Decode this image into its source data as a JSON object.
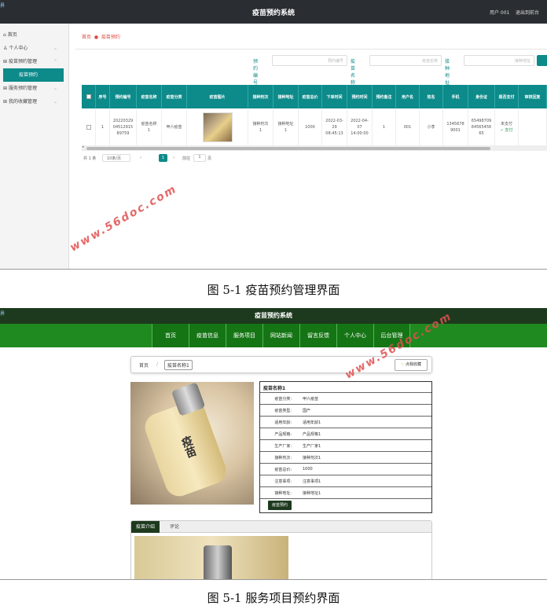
{
  "fig1": {
    "corner": "界",
    "system_title": "疫苗预约系统",
    "user_text": "用户 001",
    "logout": "退出到前台",
    "sidebar": [
      {
        "icon": "home-icon",
        "label": "首页"
      },
      {
        "icon": "user-icon",
        "label": "个人中心"
      },
      {
        "icon": "grid-icon",
        "label": "疫苗预约管理"
      },
      {
        "label": "疫苗预约"
      },
      {
        "icon": "grid-icon",
        "label": "服务预约管理"
      },
      {
        "icon": "grid-icon",
        "label": "我的收藏管理"
      }
    ],
    "breadcrumb": {
      "home": "首页",
      "current": "疫苗预约"
    },
    "search": [
      {
        "label": "预约编号",
        "placeholder": "预约编号"
      },
      {
        "label": "疫苗名称",
        "placeholder": "疫苗名称"
      },
      {
        "label": "接种地址",
        "placeholder": "接种地址"
      }
    ],
    "columns": [
      "",
      "序号",
      "预约编号",
      "疫苗名称",
      "疫苗分类",
      "疫苗图片",
      "接种剂次",
      "接种地址",
      "疫苗总价",
      "下单时间",
      "预约时间",
      "预约备注",
      "用户名",
      "姓名",
      "手机",
      "身份证",
      "是否支付",
      "审核回复"
    ],
    "row": {
      "index": "1",
      "order_no": "202203290451291589759",
      "name": "疫苗名称1",
      "category": "甲六疫苗",
      "dose": "接种剂次1",
      "address": "接种地址1",
      "price": "1000",
      "order_time": "2022-03-29 08:45:13",
      "appoint_time": "2022-04-07 14:00:00",
      "remark": "1",
      "username": "001",
      "realname": "小李",
      "phone": "13456789001",
      "idcard": "654987098456545665",
      "pay_status": "未支付",
      "pay_link": "支付"
    },
    "pager": {
      "total": "共 1 条",
      "size": "10条/页",
      "current": "1",
      "goto": "前往",
      "goto_val": "1",
      "page_unit": "页"
    }
  },
  "watermark1": "www.56doc.com",
  "caption1": "图 5-1 疫苗预约管理界面",
  "fig2": {
    "corner": "界",
    "system_title": "疫苗预约系统",
    "nav": [
      "首页",
      "疫苗信息",
      "服务项目",
      "网站新闻",
      "留言反馈",
      "个人中心",
      "后台管理"
    ],
    "breadcrumb": {
      "home": "首页",
      "sep": "/",
      "current": "疫苗名称1"
    },
    "fav_btn": "点我收藏",
    "image_text": "疫苗",
    "info_title": "疫苗名称1",
    "info_rows": [
      {
        "k": "疫苗分类:",
        "v": "甲六疫苗"
      },
      {
        "k": "疫苗类型:",
        "v": "国产"
      },
      {
        "k": "适用年龄:",
        "v": "适用年龄1"
      },
      {
        "k": "产品规格:",
        "v": "产品规格1"
      },
      {
        "k": "生产厂家:",
        "v": "生产厂家1"
      },
      {
        "k": "接种剂次:",
        "v": "接种剂次1"
      },
      {
        "k": "疫苗总价:",
        "v": "1000"
      },
      {
        "k": "注意事项:",
        "v": "注意事项1"
      },
      {
        "k": "接种地址:",
        "v": "接种地址1"
      }
    ],
    "order_btn": "疫苗预约",
    "tabs": [
      "疫苗介绍",
      "评论"
    ]
  },
  "watermark2": "www.56doc.com",
  "caption2": "图 5-1 服务项目预约界面"
}
